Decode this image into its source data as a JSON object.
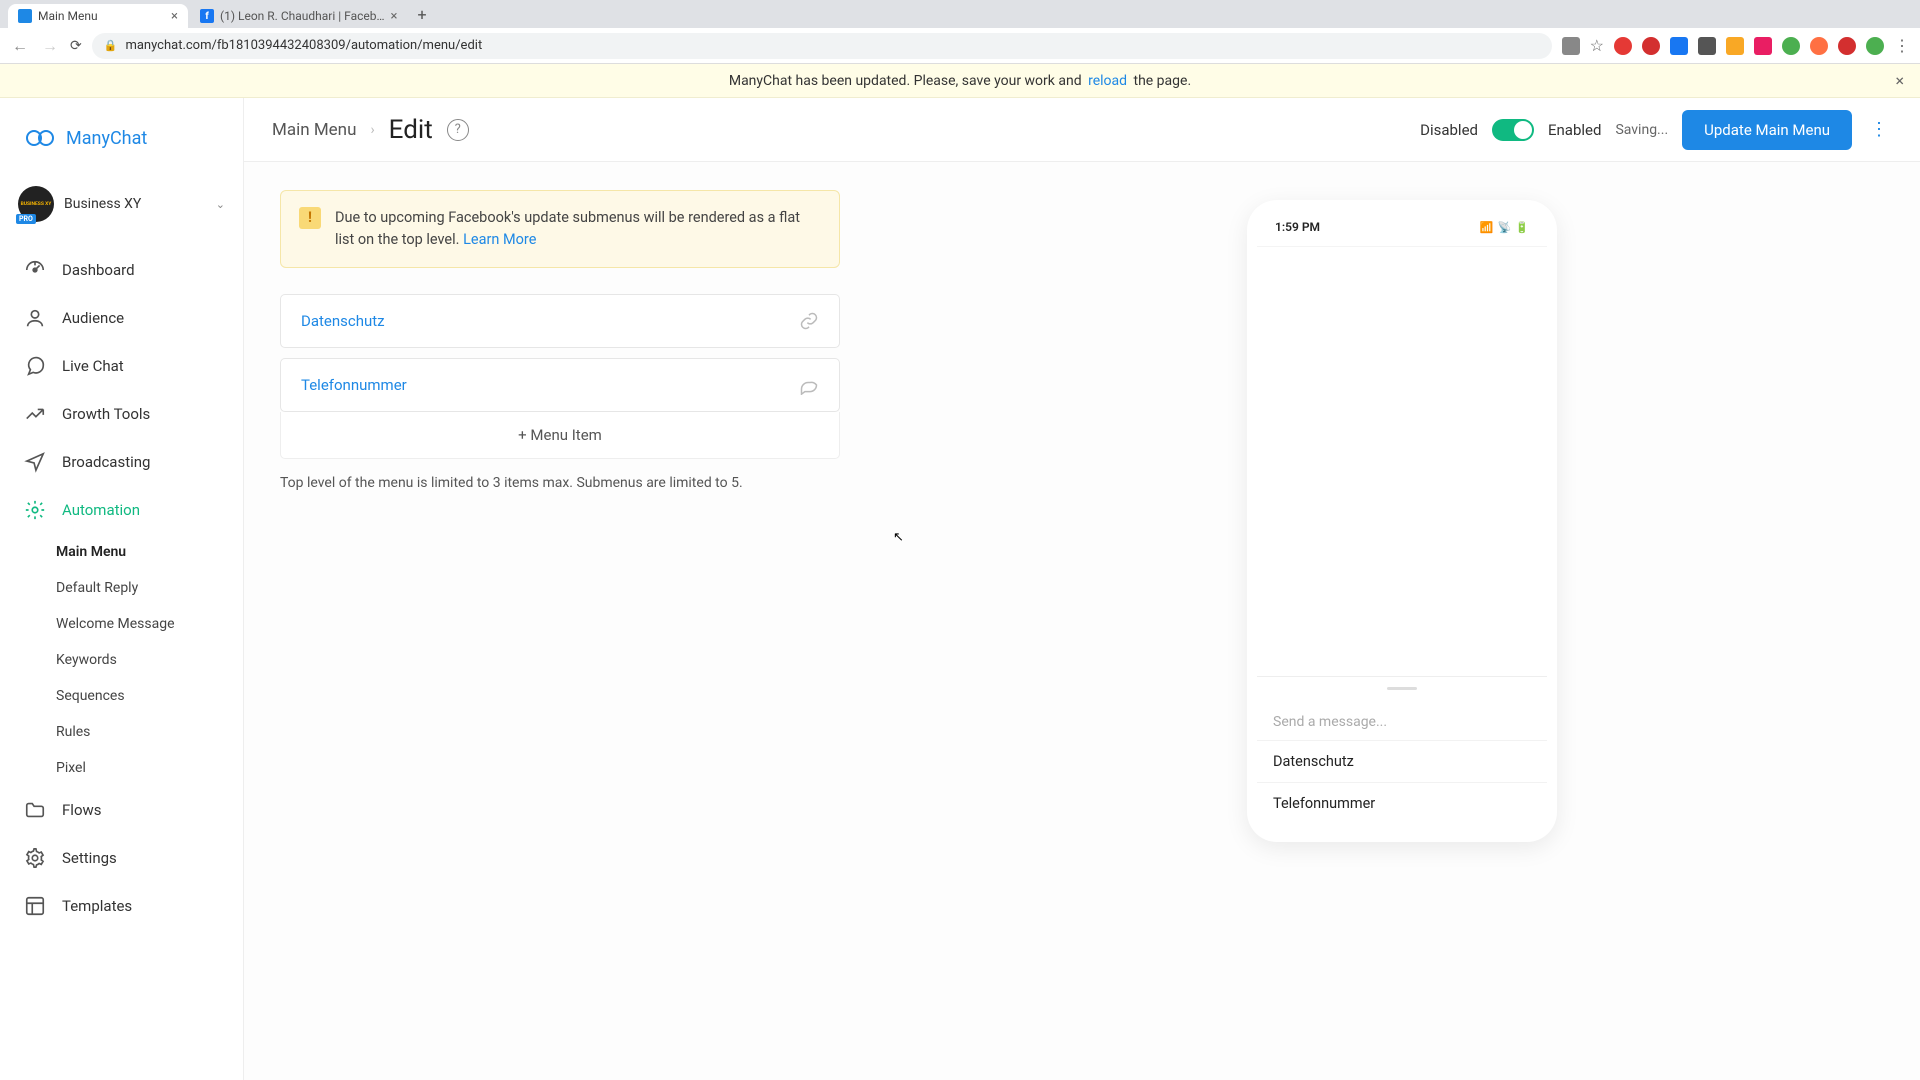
{
  "browser": {
    "tabs": [
      {
        "title": "Main Menu",
        "favicon_bg": "#1e88e5",
        "favicon_char": "",
        "active": true
      },
      {
        "title": "(1) Leon R. Chaudhari | Faceb…",
        "favicon_bg": "#1877f2",
        "favicon_char": "f",
        "active": false
      }
    ],
    "url": "manychat.com/fb181039443240830­9/automation/menu/edit"
  },
  "notification": {
    "before": "ManyChat has been updated. Please, save your work and ",
    "link": "reload",
    "after": " the page."
  },
  "sidebar": {
    "brand": "ManyChat",
    "account": {
      "name": "Business XY",
      "avatar_label": "BUSINESS XY",
      "pro": "PRO"
    },
    "nav": [
      {
        "label": "Dashboard",
        "icon": "speed"
      },
      {
        "label": "Audience",
        "icon": "user"
      },
      {
        "label": "Live Chat",
        "icon": "chat"
      },
      {
        "label": "Growth Tools",
        "icon": "growth"
      },
      {
        "label": "Broadcasting",
        "icon": "send"
      },
      {
        "label": "Automation",
        "icon": "gear",
        "active": true,
        "sub": [
          {
            "label": "Main Menu",
            "active": true
          },
          {
            "label": "Default Reply"
          },
          {
            "label": "Welcome Message"
          },
          {
            "label": "Keywords"
          },
          {
            "label": "Sequences"
          },
          {
            "label": "Rules"
          },
          {
            "label": "Pixel"
          }
        ]
      },
      {
        "label": "Flows",
        "icon": "folder"
      },
      {
        "label": "Settings",
        "icon": "gear2"
      },
      {
        "label": "Templates",
        "icon": "template"
      }
    ]
  },
  "topbar": {
    "crumb": "Main Menu",
    "page": "Edit",
    "disabled": "Disabled",
    "enabled": "Enabled",
    "saving": "Saving...",
    "update_btn": "Update Main Menu"
  },
  "alert": {
    "text": "Due to upcoming Facebook's update submenus will be rendered as a flat list on the top level. ",
    "link": "Learn More"
  },
  "menu_items": [
    {
      "label": "Datenschutz",
      "icon": "link"
    },
    {
      "label": "Telefonnummer",
      "icon": "reply"
    }
  ],
  "add_item": "+ Menu Item",
  "limit_text": "Top level of the menu is limited to 3 items max. Submenus are limited to 5.",
  "phone": {
    "time": "1:59 PM",
    "placeholder": "Send a message...",
    "items": [
      "Datenschutz",
      "Telefonnummer"
    ]
  }
}
